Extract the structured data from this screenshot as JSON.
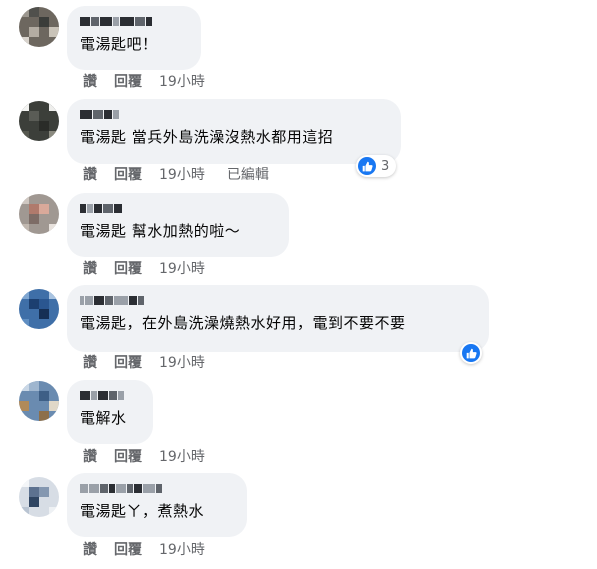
{
  "colors": {
    "bubble": "#f0f2f5",
    "text": "#050505",
    "meta": "#65676b",
    "like": "#1877f2"
  },
  "actions": {
    "like_label": "讚",
    "reply_label": "回覆"
  },
  "comments": [
    {
      "text": "電湯匙吧！",
      "time": "19小時",
      "edited": "",
      "reaction_count": ""
    },
    {
      "text": "電湯匙 當兵外島洗澡沒熱水都用這招",
      "time": "19小時",
      "edited": "已編輯",
      "reaction_count": "3",
      "reaction_icon": "like-icon"
    },
    {
      "text": "電湯匙 幫水加熱的啦～",
      "time": "19小時",
      "edited": "",
      "reaction_count": ""
    },
    {
      "text": "電湯匙，在外島洗澡燒熱水好用，電到不要不要",
      "time": "19小時",
      "edited": "",
      "reaction_count": "",
      "reaction_icon": "like-icon"
    },
    {
      "text": "電解水",
      "time": "19小時",
      "edited": "",
      "reaction_count": ""
    },
    {
      "text": "電湯匙ㄚ，煮熱水",
      "time": "19小時",
      "edited": "",
      "reaction_count": ""
    }
  ]
}
